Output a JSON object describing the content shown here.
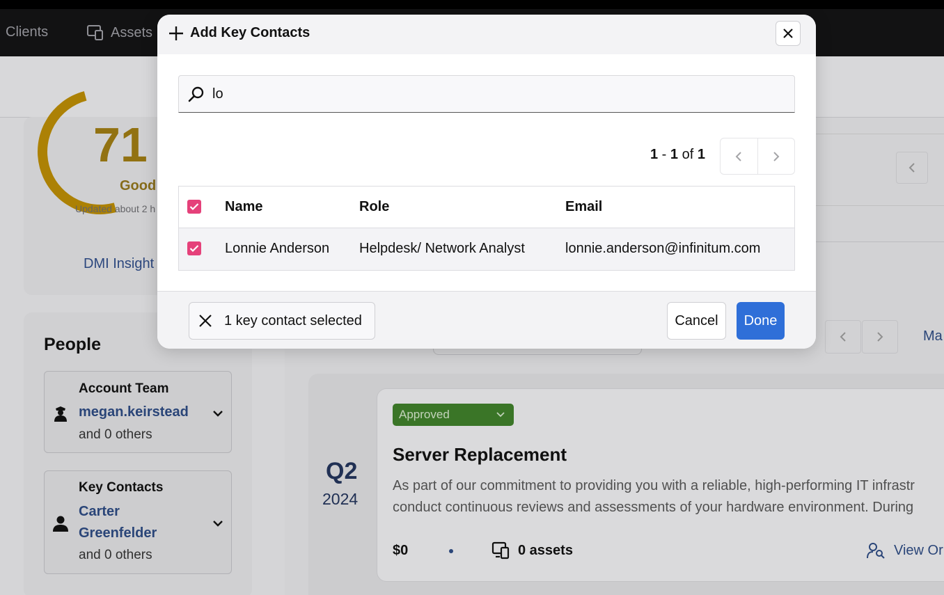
{
  "nav": {
    "items": [
      {
        "label": "Clients",
        "icon": ""
      },
      {
        "label": "Assets",
        "icon": "assets-icon"
      }
    ]
  },
  "score": {
    "value": "71",
    "label": "Good",
    "updated": "Updated about 2 h",
    "gauge_color": "#b78a06",
    "link": "DMI Insight"
  },
  "people": {
    "title": "People",
    "account_team": {
      "title": "Account Team",
      "name": "megan.keirstead",
      "others": "and 0 others"
    },
    "key_contacts": {
      "title": "Key Contacts",
      "name_line1": "Carter",
      "name_line2": "Greenfelder",
      "others": "and 0 others"
    }
  },
  "right_panel": {
    "more_link": "Ma"
  },
  "project": {
    "quarter": "Q2",
    "year": "2024",
    "status": "Approved",
    "status_color": "#3e7d2a",
    "title": "Server Replacement",
    "desc_line1": "As part of our commitment to providing you with a reliable, high-performing IT infrastr",
    "desc_line2": "conduct continuous reviews and assessments of your hardware environment. During",
    "cost": "$0",
    "assets": "0 assets",
    "view_link": "View Or"
  },
  "modal": {
    "title": "Add Key Contacts",
    "search": {
      "value": "lo",
      "placeholder": ""
    },
    "pagination": {
      "start": "1",
      "end": "1",
      "of": "of",
      "total": "1"
    },
    "columns": [
      "Name",
      "Role",
      "Email"
    ],
    "rows": [
      {
        "name": "Lonnie Anderson",
        "role": "Helpdesk/ Network Analyst",
        "email": "lonnie.anderson@infinitum.com",
        "checked": true
      }
    ],
    "selection_label": "1 key contact selected",
    "cancel_label": "Cancel",
    "done_label": "Done",
    "accent_color": "#2f6fd8",
    "checkbox_color": "#e5417a"
  }
}
